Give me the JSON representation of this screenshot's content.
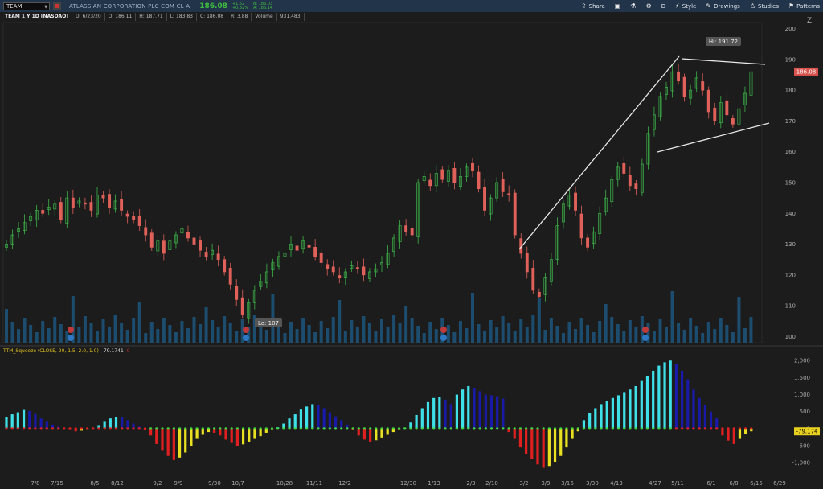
{
  "toolbar": {
    "symbol": "TEAM",
    "company": "ATLASSIAN CORPORATION PLC COM CL A",
    "last": "186.08",
    "change": "+1.52",
    "change_pct": "+0.82%",
    "bid": "B: 186.03",
    "ask": "A: 186.14",
    "share_label": "Share",
    "period_label": "D",
    "style_label": "Style",
    "drawings_label": "Drawings",
    "studies_label": "Studies",
    "patterns_label": "Patterns"
  },
  "info": {
    "title": "TEAM 1 Y 1D [NASDAQ]",
    "date": "D: 6/23/20",
    "open": "O: 186.11",
    "high": "H: 187.71",
    "low": "L: 183.83",
    "close": "C: 186.08",
    "range": "R: 3.88",
    "volume_label": "Volume",
    "volume": "931,483"
  },
  "indicator": {
    "name": "TTM_Squeeze (CLOSE, 20, 1.5, 2.0, 1.0)",
    "value": "-79.1741",
    "flag": "0"
  },
  "chart_data": [
    {
      "type": "candlestick",
      "series": [
        {
          "name": "TEAM"
        }
      ],
      "x": [
        "7/8",
        "7/15",
        "8/5",
        "8/12",
        "9/2",
        "9/9",
        "9/30",
        "10/7",
        "10/28",
        "11/11",
        "12/2",
        "12/30",
        "1/13",
        "2/3",
        "2/10",
        "3/2",
        "3/9",
        "3/16",
        "3/30",
        "4/13",
        "4/27",
        "5/11",
        "6/1",
        "6/8",
        "6/15",
        "6/29"
      ],
      "y_ticks": [
        200,
        190,
        180,
        170,
        160,
        150,
        140,
        130,
        120,
        110,
        100
      ],
      "ylim": [
        98,
        202
      ],
      "high_label": "Hi: 191.72",
      "low_label": "Lo: 107",
      "last_label": "186.08",
      "closes": [
        130,
        133,
        135,
        137,
        139,
        141,
        140,
        142,
        143,
        138,
        145,
        142,
        144,
        143,
        141,
        146,
        145,
        142,
        144,
        141,
        139,
        138,
        136,
        133,
        129,
        131,
        127,
        131,
        133,
        135,
        132,
        130,
        128,
        126,
        128,
        125,
        121,
        117,
        112,
        107,
        111,
        115,
        118,
        121,
        124,
        126,
        127,
        130,
        128,
        131,
        129,
        126,
        124,
        122,
        121,
        119,
        121,
        123,
        122,
        120,
        121,
        122,
        124,
        127,
        132,
        136,
        134,
        133,
        150,
        152,
        149,
        153,
        151,
        154,
        150,
        152,
        155,
        154,
        148,
        141,
        145,
        150,
        147,
        146,
        133,
        127,
        121,
        115,
        113,
        119,
        125,
        136,
        143,
        146,
        141,
        132,
        129,
        134,
        140,
        145,
        151,
        155,
        153,
        149,
        148,
        156,
        166,
        172,
        178,
        181,
        186,
        183,
        178,
        180,
        184,
        180,
        173,
        170,
        176,
        172,
        169,
        174,
        179,
        186
      ]
    },
    {
      "type": "bar",
      "series": [
        {
          "name": "TTM_Squeeze"
        }
      ],
      "y_ticks": [
        2000,
        1500,
        1000,
        500,
        0,
        -500,
        -1000
      ],
      "y_tick_labels": [
        "2,000",
        "1,500",
        "1,000",
        "500",
        "0",
        "-500",
        "-1,000"
      ],
      "ylim": [
        -1350,
        2100
      ],
      "last_label": "-79.174",
      "values": [
        350,
        420,
        480,
        550,
        520,
        430,
        300,
        200,
        120,
        60,
        20,
        -40,
        -80,
        -60,
        -30,
        0,
        80,
        200,
        300,
        350,
        330,
        250,
        150,
        60,
        -50,
        -200,
        -450,
        -650,
        -800,
        -920,
        -850,
        -700,
        -500,
        -300,
        -180,
        -100,
        -120,
        -200,
        -320,
        -420,
        -500,
        -460,
        -380,
        -300,
        -220,
        -120,
        -40,
        40,
        150,
        300,
        420,
        560,
        650,
        720,
        690,
        600,
        480,
        360,
        250,
        120,
        -50,
        -200,
        -320,
        -380,
        -340,
        -260,
        -180,
        -100,
        -40,
        30,
        180,
        400,
        600,
        780,
        900,
        930,
        850,
        720,
        1000,
        1150,
        1250,
        1200,
        1100,
        1000,
        980,
        950,
        880,
        -100,
        -300,
        -550,
        -750,
        -900,
        -1050,
        -1150,
        -1120,
        -980,
        -800,
        -550,
        -300,
        -80,
        250,
        450,
        600,
        720,
        820,
        900,
        980,
        1050,
        1150,
        1250,
        1400,
        1550,
        1700,
        1850,
        1950,
        2000,
        1900,
        1700,
        1450,
        1150,
        900,
        700,
        500,
        300,
        -200,
        -350,
        -450,
        -300,
        -150,
        -79
      ]
    }
  ]
}
